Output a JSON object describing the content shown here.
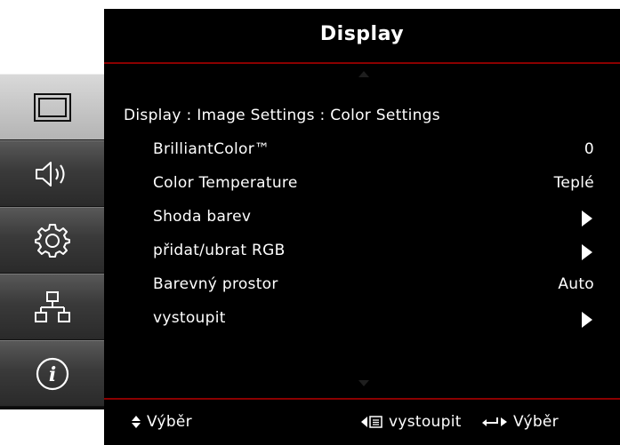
{
  "header": {
    "title": "Display"
  },
  "breadcrumb": "Display : Image Settings : Color Settings",
  "menu": [
    {
      "label": "BrilliantColor™",
      "value": "0",
      "has_submenu": false
    },
    {
      "label": "Color Temperature",
      "value": "Teplé",
      "has_submenu": false
    },
    {
      "label": "Shoda barev",
      "value": "",
      "has_submenu": true
    },
    {
      "label": "přidat/ubrat RGB",
      "value": "",
      "has_submenu": true
    },
    {
      "label": "Barevný prostor",
      "value": "Auto",
      "has_submenu": false
    },
    {
      "label": "vystoupit",
      "value": "",
      "has_submenu": true
    }
  ],
  "sidebar": {
    "items": [
      {
        "icon": "display-icon",
        "active": true
      },
      {
        "icon": "speaker-icon",
        "active": false
      },
      {
        "icon": "gear-icon",
        "active": false
      },
      {
        "icon": "network-icon",
        "active": false
      },
      {
        "icon": "info-icon",
        "active": false
      }
    ]
  },
  "footer": {
    "select_label": "Výběr",
    "back_label": "vystoupit",
    "enter_label": "Výběr"
  },
  "colors": {
    "accent_line": "#8b0000",
    "background": "#000000",
    "text": "#ffffff"
  }
}
